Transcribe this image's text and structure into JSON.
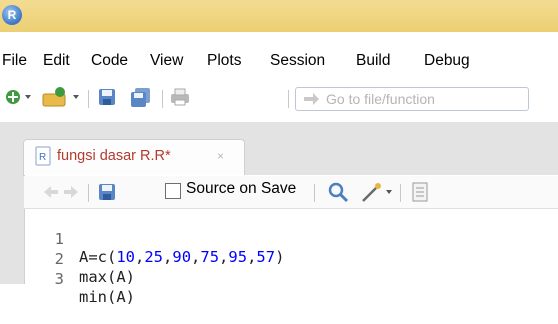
{
  "app": {
    "logo_letter": "R"
  },
  "menu": [
    "File",
    "Edit",
    "Code",
    "View",
    "Plots",
    "Session",
    "Build",
    "Debug"
  ],
  "toolbar": {
    "goto_placeholder": "Go to file/function"
  },
  "tab": {
    "label": "fungsi dasar R.R*",
    "close": "×"
  },
  "editor_toolbar": {
    "source_on_save": "Source on Save",
    "source_on_save_checked": false
  },
  "editor": {
    "lines": [
      {
        "n": "1",
        "code": "A=c(10,25,90,75,95,57)"
      },
      {
        "n": "2",
        "code": "max(A)"
      },
      {
        "n": "3",
        "code": "min(A)"
      }
    ]
  },
  "colors": {
    "titlebar": "#eccf73",
    "tab_text": "#b23b2e",
    "number": "#0000ff"
  }
}
